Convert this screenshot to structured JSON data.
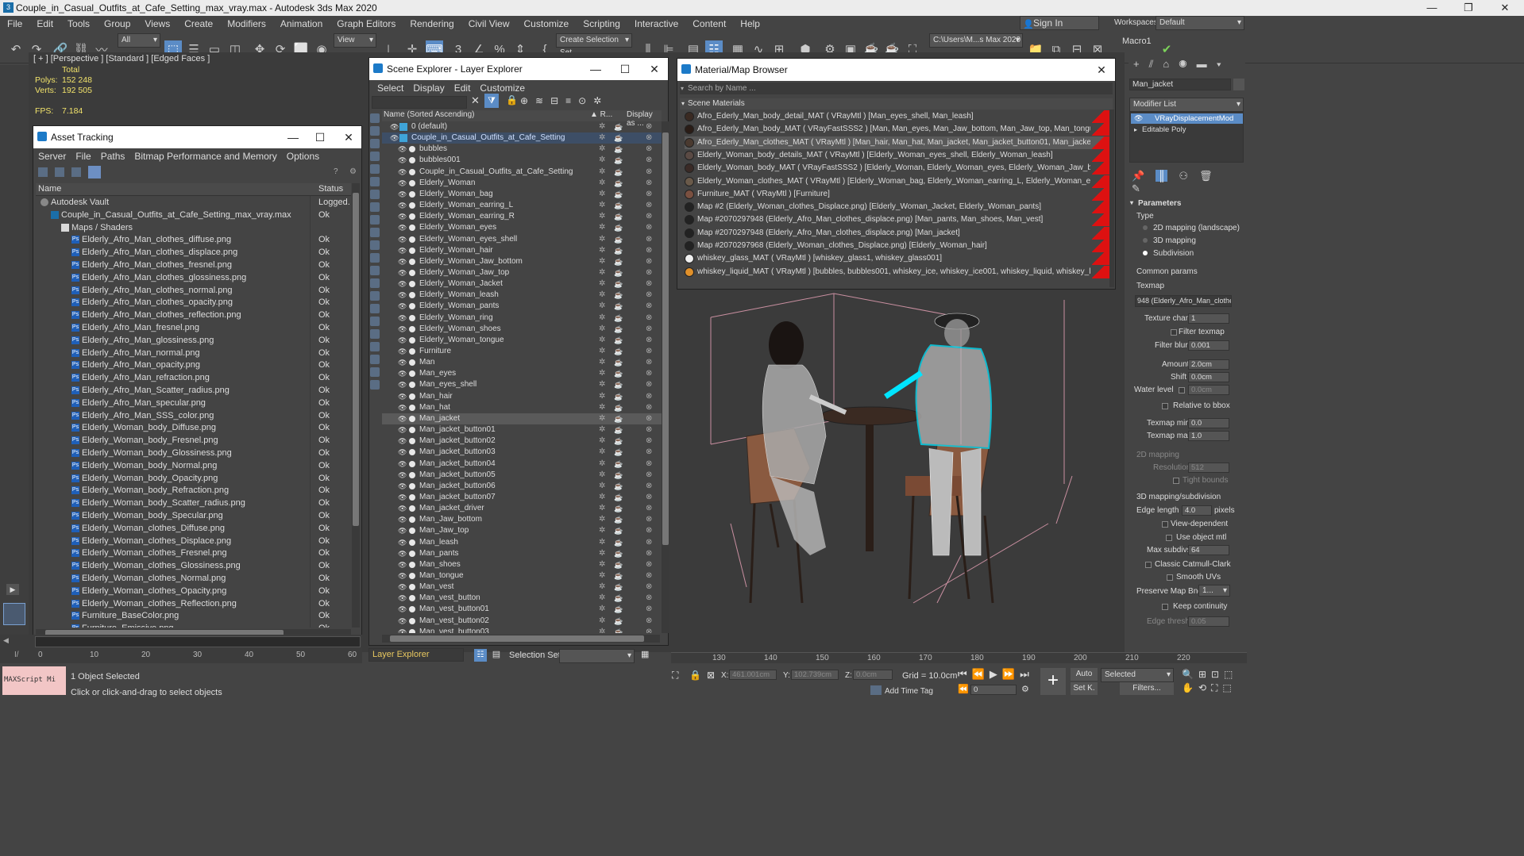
{
  "window": {
    "title": "Couple_in_Casual_Outfits_at_Cafe_Setting_max_vray.max - Autodesk 3ds Max 2020",
    "minimize": "—",
    "restore": "❐",
    "close": "✕"
  },
  "menu": [
    "File",
    "Edit",
    "Tools",
    "Group",
    "Views",
    "Create",
    "Modifiers",
    "Animation",
    "Graph Editors",
    "Rendering",
    "Civil View",
    "Customize",
    "Scripting",
    "Interactive",
    "Content",
    "Help"
  ],
  "account": {
    "sign_in": "Sign In",
    "workspaces_label": "Workspaces:",
    "workspace": "Default"
  },
  "toolbar": {
    "filter": "All",
    "view": "View",
    "selection_set": "Create Selection Set",
    "path": "C:\\Users\\M...s Max 2020",
    "macro": "Macro1"
  },
  "viewport": {
    "label": "[ + ] [Perspective ] [Standard ] [Edged Faces ]",
    "total": "Total",
    "polys_label": "Polys:",
    "polys": "152 248",
    "verts_label": "Verts:",
    "verts": "192 505",
    "fps_label": "FPS:",
    "fps": "7.184"
  },
  "asset_tracking": {
    "title": "Asset Tracking",
    "menu": [
      "Server",
      "File",
      "Paths",
      "Bitmap Performance and Memory",
      "Options"
    ],
    "col_name": "Name",
    "col_status": "Status",
    "rows": [
      {
        "name": "Autodesk Vault",
        "status": "Logged...",
        "indent": 0,
        "icon": "vault"
      },
      {
        "name": "Couple_in_Casual_Outfits_at_Cafe_Setting_max_vray.max",
        "status": "Ok",
        "indent": 1,
        "icon": "max"
      },
      {
        "name": "Maps / Shaders",
        "status": "",
        "indent": 2,
        "icon": "folder"
      },
      {
        "name": "Elderly_Afro_Man_clothes_diffuse.png",
        "status": "Ok",
        "indent": 3,
        "icon": "ps"
      },
      {
        "name": "Elderly_Afro_Man_clothes_displace.png",
        "status": "Ok",
        "indent": 3,
        "icon": "ps"
      },
      {
        "name": "Elderly_Afro_Man_clothes_fresnel.png",
        "status": "Ok",
        "indent": 3,
        "icon": "ps"
      },
      {
        "name": "Elderly_Afro_Man_clothes_glossiness.png",
        "status": "Ok",
        "indent": 3,
        "icon": "ps"
      },
      {
        "name": "Elderly_Afro_Man_clothes_normal.png",
        "status": "Ok",
        "indent": 3,
        "icon": "ps"
      },
      {
        "name": "Elderly_Afro_Man_clothes_opacity.png",
        "status": "Ok",
        "indent": 3,
        "icon": "ps"
      },
      {
        "name": "Elderly_Afro_Man_clothes_reflection.png",
        "status": "Ok",
        "indent": 3,
        "icon": "ps"
      },
      {
        "name": "Elderly_Afro_Man_fresnel.png",
        "status": "Ok",
        "indent": 3,
        "icon": "ps"
      },
      {
        "name": "Elderly_Afro_Man_glossiness.png",
        "status": "Ok",
        "indent": 3,
        "icon": "ps"
      },
      {
        "name": "Elderly_Afro_Man_normal.png",
        "status": "Ok",
        "indent": 3,
        "icon": "ps"
      },
      {
        "name": "Elderly_Afro_Man_opacity.png",
        "status": "Ok",
        "indent": 3,
        "icon": "ps"
      },
      {
        "name": "Elderly_Afro_Man_refraction.png",
        "status": "Ok",
        "indent": 3,
        "icon": "ps"
      },
      {
        "name": "Elderly_Afro_Man_Scatter_radius.png",
        "status": "Ok",
        "indent": 3,
        "icon": "ps"
      },
      {
        "name": "Elderly_Afro_Man_specular.png",
        "status": "Ok",
        "indent": 3,
        "icon": "ps"
      },
      {
        "name": "Elderly_Afro_Man_SSS_color.png",
        "status": "Ok",
        "indent": 3,
        "icon": "ps"
      },
      {
        "name": "Elderly_Woman_body_Diffuse.png",
        "status": "Ok",
        "indent": 3,
        "icon": "ps"
      },
      {
        "name": "Elderly_Woman_body_Fresnel.png",
        "status": "Ok",
        "indent": 3,
        "icon": "ps"
      },
      {
        "name": "Elderly_Woman_body_Glossiness.png",
        "status": "Ok",
        "indent": 3,
        "icon": "ps"
      },
      {
        "name": "Elderly_Woman_body_Normal.png",
        "status": "Ok",
        "indent": 3,
        "icon": "ps"
      },
      {
        "name": "Elderly_Woman_body_Opacity.png",
        "status": "Ok",
        "indent": 3,
        "icon": "ps"
      },
      {
        "name": "Elderly_Woman_body_Refraction.png",
        "status": "Ok",
        "indent": 3,
        "icon": "ps"
      },
      {
        "name": "Elderly_Woman_body_Scatter_radius.png",
        "status": "Ok",
        "indent": 3,
        "icon": "ps"
      },
      {
        "name": "Elderly_Woman_body_Specular.png",
        "status": "Ok",
        "indent": 3,
        "icon": "ps"
      },
      {
        "name": "Elderly_Woman_clothes_Diffuse.png",
        "status": "Ok",
        "indent": 3,
        "icon": "ps"
      },
      {
        "name": "Elderly_Woman_clothes_Displace.png",
        "status": "Ok",
        "indent": 3,
        "icon": "ps"
      },
      {
        "name": "Elderly_Woman_clothes_Fresnel.png",
        "status": "Ok",
        "indent": 3,
        "icon": "ps"
      },
      {
        "name": "Elderly_Woman_clothes_Glossiness.png",
        "status": "Ok",
        "indent": 3,
        "icon": "ps"
      },
      {
        "name": "Elderly_Woman_clothes_Normal.png",
        "status": "Ok",
        "indent": 3,
        "icon": "ps"
      },
      {
        "name": "Elderly_Woman_clothes_Opacity.png",
        "status": "Ok",
        "indent": 3,
        "icon": "ps"
      },
      {
        "name": "Elderly_Woman_clothes_Reflection.png",
        "status": "Ok",
        "indent": 3,
        "icon": "ps"
      },
      {
        "name": "Furniture_BaseColor.png",
        "status": "Ok",
        "indent": 3,
        "icon": "ps"
      },
      {
        "name": "Furniture_Emissive.png",
        "status": "Ok",
        "indent": 3,
        "icon": "ps"
      }
    ]
  },
  "scene_explorer": {
    "title": "Scene Explorer - Layer Explorer",
    "menu": [
      "Select",
      "Display",
      "Edit",
      "Customize"
    ],
    "col_name": "Name (Sorted Ascending)",
    "col_r": "▲ R...",
    "col_display": "Display as ...",
    "layers": [
      {
        "name": "0 (default)",
        "level": 0
      },
      {
        "name": "Couple_in_Casual_Outfits_at_Cafe_Setting",
        "level": 0,
        "highlight": true
      },
      {
        "name": "bubbles",
        "level": 1
      },
      {
        "name": "bubbles001",
        "level": 1
      },
      {
        "name": "Couple_in_Casual_Outfits_at_Cafe_Setting",
        "level": 1
      },
      {
        "name": "Elderly_Woman",
        "level": 1
      },
      {
        "name": "Elderly_Woman_bag",
        "level": 1
      },
      {
        "name": "Elderly_Woman_earring_L",
        "level": 1
      },
      {
        "name": "Elderly_Woman_earring_R",
        "level": 1
      },
      {
        "name": "Elderly_Woman_eyes",
        "level": 1
      },
      {
        "name": "Elderly_Woman_eyes_shell",
        "level": 1
      },
      {
        "name": "Elderly_Woman_hair",
        "level": 1
      },
      {
        "name": "Elderly_Woman_Jaw_bottom",
        "level": 1
      },
      {
        "name": "Elderly_Woman_Jaw_top",
        "level": 1
      },
      {
        "name": "Elderly_Woman_Jacket",
        "level": 1
      },
      {
        "name": "Elderly_Woman_leash",
        "level": 1
      },
      {
        "name": "Elderly_Woman_pants",
        "level": 1
      },
      {
        "name": "Elderly_Woman_ring",
        "level": 1
      },
      {
        "name": "Elderly_Woman_shoes",
        "level": 1
      },
      {
        "name": "Elderly_Woman_tongue",
        "level": 1
      },
      {
        "name": "Furniture",
        "level": 1
      },
      {
        "name": "Man",
        "level": 1
      },
      {
        "name": "Man_eyes",
        "level": 1
      },
      {
        "name": "Man_eyes_shell",
        "level": 1
      },
      {
        "name": "Man_hair",
        "level": 1
      },
      {
        "name": "Man_hat",
        "level": 1
      },
      {
        "name": "Man_jacket",
        "level": 1,
        "selected": true
      },
      {
        "name": "Man_jacket_button01",
        "level": 1
      },
      {
        "name": "Man_jacket_button02",
        "level": 1
      },
      {
        "name": "Man_jacket_button03",
        "level": 1
      },
      {
        "name": "Man_jacket_button04",
        "level": 1
      },
      {
        "name": "Man_jacket_button05",
        "level": 1
      },
      {
        "name": "Man_jacket_button06",
        "level": 1
      },
      {
        "name": "Man_jacket_button07",
        "level": 1
      },
      {
        "name": "Man_jacket_driver",
        "level": 1
      },
      {
        "name": "Man_Jaw_bottom",
        "level": 1
      },
      {
        "name": "Man_Jaw_top",
        "level": 1
      },
      {
        "name": "Man_leash",
        "level": 1
      },
      {
        "name": "Man_pants",
        "level": 1
      },
      {
        "name": "Man_shoes",
        "level": 1
      },
      {
        "name": "Man_tongue",
        "level": 1
      },
      {
        "name": "Man_vest",
        "level": 1
      },
      {
        "name": "Man_vest_button",
        "level": 1
      },
      {
        "name": "Man_vest_button01",
        "level": 1
      },
      {
        "name": "Man_vest_button02",
        "level": 1
      },
      {
        "name": "Man_vest_button03",
        "level": 1
      }
    ],
    "footer_label": "Layer Explorer",
    "selection_set_label": "Selection Set:"
  },
  "material_browser": {
    "title": "Material/Map Browser",
    "search_placeholder": "Search by Name ...",
    "section": "Scene Materials",
    "materials": [
      {
        "text": "Afro_Ederly_Man_body_detail_MAT  ( VRayMtl ) [Man_eyes_shell, Man_leash]",
        "swatch": "#3a2a22"
      },
      {
        "text": "Afro_Ederly_Man_body_MAT  ( VRayFastSSS2 ) [Man, Man_eyes, Man_Jaw_bottom, Man_Jaw_top, Man_tongue]",
        "swatch": "#2a1c16"
      },
      {
        "text": "Afro_Ederly_Man_clothes_MAT  ( VRayMtl ) [Man_hair, Man_hat, Man_jacket, Man_jacket_button01, Man_jacket_button02, M...",
        "swatch": "#4a3a30",
        "selected": true
      },
      {
        "text": "Elderly_Woman_body_details_MAT  ( VRayMtl ) [Elderly_Woman_eyes_shell, Elderly_Woman_leash]",
        "swatch": "#5a4a44"
      },
      {
        "text": "Elderly_Woman_body_MAT  ( VRayFastSSS2 ) [Elderly_Woman, Elderly_Woman_eyes, Elderly_Woman_Jaw_bottom, Elderly_...",
        "swatch": "#3a2a26"
      },
      {
        "text": "Elderly_Woman_clothes_MAT  ( VRayMtl ) [Elderly_Woman_bag, Elderly_Woman_earring_L, Elderly_Woman_earring_R, Elderl...",
        "swatch": "#6a5a4a"
      },
      {
        "text": "Furniture_MAT  ( VRayMtl ) [Furniture]",
        "swatch": "#7a5040"
      },
      {
        "text": "Map #2 (Elderly_Woman_clothes_Displace.png)  [Elderly_Woman_Jacket, Elderly_Woman_pants]",
        "swatch": "#222"
      },
      {
        "text": "Map #2070297948 (Elderly_Afro_Man_clothes_displace.png)  [Man_pants, Man_shoes, Man_vest]",
        "swatch": "#222"
      },
      {
        "text": "Map #2070297948 (Elderly_Afro_Man_clothes_displace.png)  [Man_jacket]",
        "swatch": "#222"
      },
      {
        "text": "Map #2070297968 (Elderly_Woman_clothes_Displace.png)  [Elderly_Woman_hair]",
        "swatch": "#222"
      },
      {
        "text": "whiskey_glass_MAT  ( VRayMtl ) [whiskey_glass1, whiskey_glass001]",
        "swatch": "#f0f0f0"
      },
      {
        "text": "whiskey_liquid_MAT  ( VRayMtl ) [bubbles, bubbles001, whiskey_ice, whiskey_ice001, whiskey_liquid, whiskey_liquid001]",
        "swatch": "#e0902a"
      }
    ]
  },
  "command_panel": {
    "object_name": "Man_jacket",
    "modifier_list": "Modifier List",
    "stack": [
      "VRayDisplacementMod",
      "Editable Poly"
    ],
    "parameters": "Parameters",
    "type_label": "Type",
    "type_options": [
      "2D mapping (landscape)",
      "3D mapping",
      "Subdivision"
    ],
    "common_params": "Common params",
    "texmap_label": "Texmap",
    "texmap_value": "948 (Elderly_Afro_Man_clothe",
    "texture_chan_label": "Texture chan",
    "texture_chan": "1",
    "filter_texmap": "Filter texmap",
    "filter_blur_label": "Filter blur",
    "filter_blur": "0.001",
    "amount_label": "Amount",
    "amount": "2.0cm",
    "shift_label": "Shift",
    "shift": "0.0cm",
    "water_level_label": "Water level",
    "water_level": "0.0cm",
    "relative_to_bbox": "Relative to bbox",
    "texmap_min_label": "Texmap min",
    "texmap_min": "0.0",
    "texmap_max_label": "Texmap max",
    "texmap_max": "1.0",
    "mapping_2d": "2D mapping",
    "resolution_label": "Resolution",
    "resolution": "512",
    "tight_bounds": "Tight bounds",
    "mapping_3d": "3D mapping/subdivision",
    "edge_length_label": "Edge length",
    "edge_length": "4.0",
    "pixels": "pixels",
    "view_dependent": "View-dependent",
    "use_object_mtl": "Use object mtl",
    "max_subdivs_label": "Max subdivs",
    "max_subdivs": "64",
    "classic_catmull": "Classic Catmull-Clark",
    "smooth_uvs": "Smooth UVs",
    "preserve_map_bnd_label": "Preserve Map Bnd",
    "preserve_map_bnd": "1...",
    "keep_continuity": "Keep continuity",
    "edge_thresh_label": "Edge thresh",
    "edge_thresh": "0.05"
  },
  "timeline": {
    "ticks": [
      "130",
      "140",
      "150",
      "160",
      "170",
      "180",
      "190",
      "200",
      "210",
      "220"
    ],
    "left_ticks": [
      "0",
      "10",
      "20",
      "30",
      "40",
      "50",
      "60"
    ]
  },
  "status": {
    "maxscript": "MAXScript Mi",
    "selected": "1 Object Selected",
    "hint": "Click or click-and-drag to select objects",
    "x_label": "X:",
    "x": "461.001cm",
    "y_label": "Y:",
    "y": "102.739cm",
    "z_label": "Z:",
    "z": "0.0cm",
    "grid": "Grid = 10.0cm",
    "add_time_tag": "Add Time Tag",
    "auto": "Auto",
    "set_k": "Set K.",
    "selected_dd": "Selected",
    "filters": "Filters...",
    "frame": "0"
  }
}
